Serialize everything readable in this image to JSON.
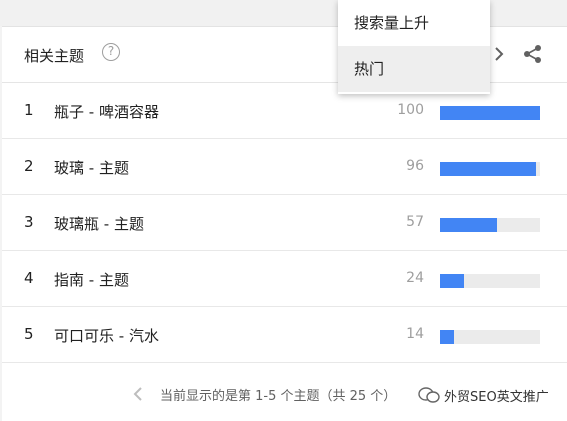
{
  "panel": {
    "title": "相关主题",
    "help_icon": "help-circle-icon",
    "next_icon": "chevron-right-icon",
    "share_icon": "share-icon"
  },
  "menu": {
    "items": [
      {
        "label": "搜索量上升",
        "selected": false
      },
      {
        "label": "热门",
        "selected": true
      }
    ]
  },
  "rows": [
    {
      "rank": "1",
      "name": "瓶子 - 啤酒容器",
      "value": "100",
      "percent": 100
    },
    {
      "rank": "2",
      "name": "玻璃 - 主题",
      "value": "96",
      "percent": 96
    },
    {
      "rank": "3",
      "name": "玻璃瓶 - 主题",
      "value": "57",
      "percent": 57
    },
    {
      "rank": "4",
      "name": "指南 - 主题",
      "value": "24",
      "percent": 24
    },
    {
      "rank": "5",
      "name": "可口可乐 - 汽水",
      "value": "14",
      "percent": 14
    }
  ],
  "footer": {
    "prev_icon": "chevron-left-icon",
    "pagination_text": "当前显示的是第 1-5 个主题（共 25 个）",
    "watermark_text": "外贸SEO英文推广"
  },
  "colors": {
    "bar": "#4285f4",
    "track": "#ebebeb"
  }
}
